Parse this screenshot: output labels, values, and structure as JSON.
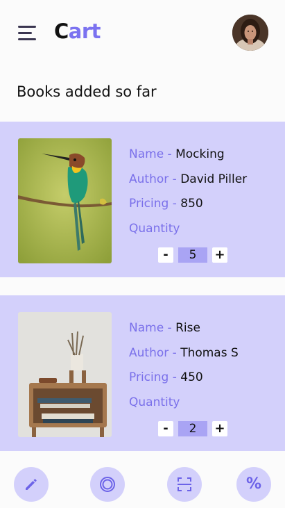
{
  "app": {
    "title_first_letter": "C",
    "title_rest": "art"
  },
  "header": {
    "menu_icon": "hamburger-menu-icon",
    "avatar": "user-avatar-photo"
  },
  "section": {
    "title": "Books added so far"
  },
  "cart": {
    "items": [
      {
        "name_label": "Name - ",
        "name": "Mocking",
        "author_label": "Author - ",
        "author": "David Piller",
        "pricing_label": "Pricing - ",
        "pricing": "850",
        "quantity_label": "Quantity",
        "quantity": "5",
        "minus_label": "-",
        "plus_label": "+",
        "image": "bird-on-branch-photo"
      },
      {
        "name_label": "Name - ",
        "name": "Rise",
        "author_label": "Author - ",
        "author": "Thomas S",
        "pricing_label": "Pricing - ",
        "pricing": "450",
        "quantity_label": "Quantity",
        "quantity": "2",
        "minus_label": "-",
        "plus_label": "+",
        "image": "books-on-shelf-photo"
      }
    ]
  },
  "bottom_nav": {
    "items": [
      {
        "icon": "pencil-edit-icon"
      },
      {
        "icon": "target-circle-icon"
      },
      {
        "icon": "scan-frame-icon"
      },
      {
        "icon": "percent-icon",
        "label": "%"
      }
    ]
  },
  "colors": {
    "accent": "#7b72f0",
    "card_bg": "#d3d0fb",
    "qty_bg": "#a9a4f4",
    "background": "#fbfbfb"
  }
}
